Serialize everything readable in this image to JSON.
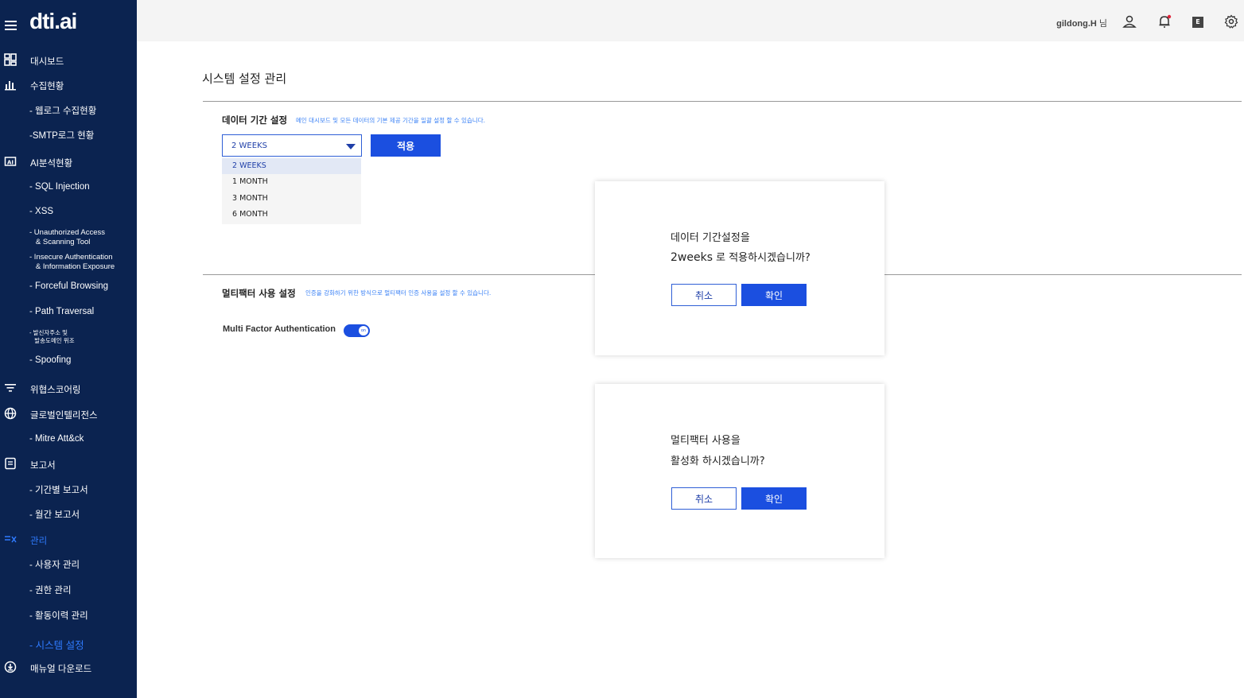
{
  "app": {
    "logo": "dti.ai"
  },
  "sidebar": {
    "items": [
      {
        "label": "대시보드",
        "icon": "dashboard-icon"
      },
      {
        "label": "수집현황",
        "icon": "bar-chart-icon"
      },
      {
        "label": "- 웹로그 수집현황"
      },
      {
        "label": "-SMTP로그 현황"
      },
      {
        "label": "AI분석현황",
        "icon": "ai-icon"
      },
      {
        "label": "- SQL Injection"
      },
      {
        "label": "- XSS"
      },
      {
        "label": "- Unauthorized Access\n   & Scanning Tool"
      },
      {
        "label": "- Insecure Authentication\n   & Information Exposure"
      },
      {
        "label": "- Forceful Browsing"
      },
      {
        "label": "- Path Traversal"
      },
      {
        "label": "- 발신자주소 및\n   발송도메인 위조"
      },
      {
        "label": "- Spoofing"
      },
      {
        "label": "위협스코어링",
        "icon": "filter-icon"
      },
      {
        "label": "글로벌인텔리전스",
        "icon": "globe-icon"
      },
      {
        "label": "- Mitre Att&ck"
      },
      {
        "label": "보고서",
        "icon": "report-icon"
      },
      {
        "label": "- 기간별 보고서"
      },
      {
        "label": "- 월간 보고서"
      },
      {
        "label": "관리",
        "icon": "admin-icon"
      },
      {
        "label": "- 사용자 관리"
      },
      {
        "label": "- 권한 관리"
      },
      {
        "label": "- 활동이력 관리"
      },
      {
        "label": "- 시스템 설정"
      },
      {
        "label": "매뉴얼 다운로드",
        "icon": "download-icon"
      }
    ],
    "active_color": "#2f7bff"
  },
  "topbar": {
    "user_name": "gildong.H",
    "user_suffix": "님",
    "lang_badge": "E"
  },
  "page": {
    "title": "시스템 설정 관리",
    "data_period": {
      "title": "데이터 기간 설정",
      "description": "메인 대시보드 및 모든 데이터의 기본 제공 기간을 일괄 설정 할 수 있습니다.",
      "selected": "2 WEEKS",
      "options": [
        "2 WEEKS",
        "1 MONTH",
        "3 MONTH",
        "6 MONTH"
      ],
      "apply_label": "적용"
    },
    "mfa": {
      "title": "멀티팩터 사용 설정",
      "description": "인증을 강화하기 위한 방식으로 멀티팩터 인증 사용을 설정 할 수 있습니다.",
      "label": "Multi Factor Authentication",
      "toggle_text": "on",
      "enabled": true
    }
  },
  "modals": {
    "period_confirm": {
      "line1": "데이터 기간설정을",
      "value": "2weeks",
      "line2_rest": " 로 적용하시겠습니까?",
      "cancel": "취소",
      "ok": "확인"
    },
    "mfa_confirm": {
      "line1": "멀티팩터 사용을",
      "line2": "활성화 하시겠습니까?",
      "cancel": "취소",
      "ok": "확인"
    }
  },
  "colors": {
    "sidebar_bg": "#0b2350",
    "primary": "#1b4fe0",
    "topbar_bg": "#f4f4f4"
  }
}
